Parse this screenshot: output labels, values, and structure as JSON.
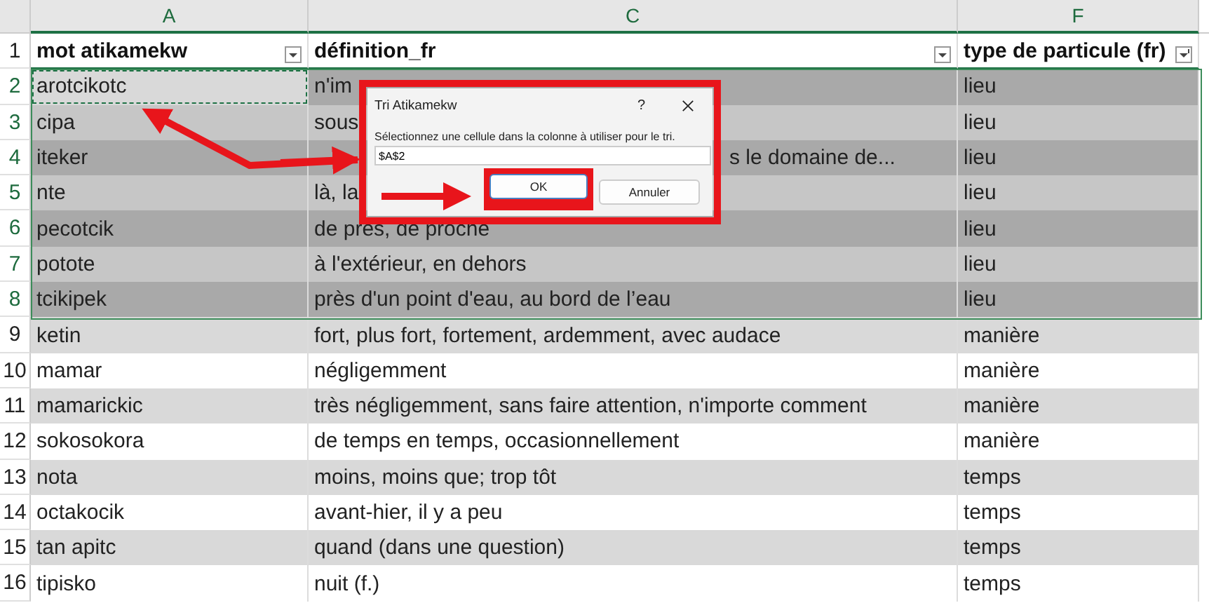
{
  "columns": [
    {
      "letter": "A",
      "selected": true
    },
    {
      "letter": "C",
      "selected": true
    },
    {
      "letter": "F",
      "selected": true
    }
  ],
  "header_row": {
    "number": "1",
    "cells": [
      "mot atikamekw",
      "définition_fr",
      "type de particule (fr)"
    ]
  },
  "rows": [
    {
      "number": "2",
      "selected": true,
      "active": true,
      "cells": [
        "arotcikotc",
        "n'im",
        "lieu"
      ]
    },
    {
      "number": "3",
      "selected": true,
      "active": false,
      "cells": [
        "cipa",
        "sous",
        "lieu"
      ]
    },
    {
      "number": "4",
      "selected": true,
      "active": false,
      "cells": [
        "iteker",
        "s le domaine de...",
        "lieu"
      ]
    },
    {
      "number": "5",
      "selected": true,
      "active": false,
      "cells": [
        "nte",
        "là, la",
        "lieu"
      ]
    },
    {
      "number": "6",
      "selected": true,
      "active": false,
      "cells": [
        "pecotcik",
        "de près, de proche",
        "lieu"
      ]
    },
    {
      "number": "7",
      "selected": true,
      "active": false,
      "cells": [
        "potote",
        "à l'extérieur, en dehors",
        "lieu"
      ]
    },
    {
      "number": "8",
      "selected": true,
      "active": false,
      "cells": [
        "tcikipek",
        "près d'un point d'eau, au bord de l’eau",
        "lieu"
      ]
    },
    {
      "number": "9",
      "selected": false,
      "active": false,
      "cells": [
        "ketin",
        "fort, plus fort, fortement, ardemment, avec audace",
        "manière"
      ]
    },
    {
      "number": "10",
      "selected": false,
      "active": false,
      "cells": [
        "mamar",
        "négligemment",
        "manière"
      ]
    },
    {
      "number": "11",
      "selected": false,
      "active": false,
      "cells": [
        "mamarickic",
        "très négligemment, sans faire attention, n'importe comment",
        "manière"
      ]
    },
    {
      "number": "12",
      "selected": false,
      "active": false,
      "cells": [
        "sokosokora",
        "de temps en temps, occasionnellement",
        "manière"
      ]
    },
    {
      "number": "13",
      "selected": false,
      "active": false,
      "cells": [
        "nota",
        "moins, moins que; trop tôt",
        "temps"
      ]
    },
    {
      "number": "14",
      "selected": false,
      "active": false,
      "cells": [
        "octakocik",
        "avant-hier, il y a peu",
        "temps"
      ]
    },
    {
      "number": "15",
      "selected": false,
      "active": false,
      "cells": [
        "tan apitc",
        "quand (dans une question)",
        "temps"
      ]
    },
    {
      "number": "16",
      "selected": false,
      "active": false,
      "cells": [
        "tipisko",
        "nuit (f.)",
        "temps"
      ]
    }
  ],
  "dialog": {
    "title": "Tri Atikamekw",
    "help": "?",
    "prompt": "Sélectionnez une cellule dans la colonne à utiliser pour le tri.",
    "value": "$A$2",
    "buttons": [
      {
        "label": "OK",
        "selected": true
      },
      {
        "label": "Annuler",
        "selected": false
      }
    ]
  }
}
